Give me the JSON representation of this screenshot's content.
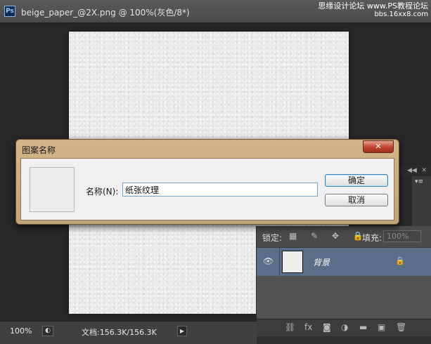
{
  "document": {
    "app_badge": "Ps",
    "tab_title": "beige_paper_@2X.png @ 100%(灰色/8*)"
  },
  "watermark": {
    "line1": "思缘设计论坛 www.PS教程论坛",
    "line2": "bbs.16xx8.com"
  },
  "dialog": {
    "title": "图案名称",
    "close_label": "✕",
    "name_label": "名称(N):",
    "name_value": "纸张纹理",
    "ok_label": "确定",
    "cancel_label": "取消"
  },
  "layers_panel": {
    "lock_label": "锁定:",
    "lock_icons": "▦ ✎ ✥ 🔒",
    "fill_label": "填充:",
    "fill_value": "100%",
    "layer_name": "背景",
    "layer_lock_icon": "🔒",
    "actions": [
      "⛓",
      "fx",
      "◙",
      "◑",
      "▬",
      "▣",
      "🗑"
    ]
  },
  "status_bar": {
    "zoom": "100%",
    "doc_size": "文档:156.3K/156.3K",
    "arrow": "▶"
  },
  "panel": {
    "collapse": "◀◀",
    "close": "✕",
    "menu": "▾≡"
  }
}
